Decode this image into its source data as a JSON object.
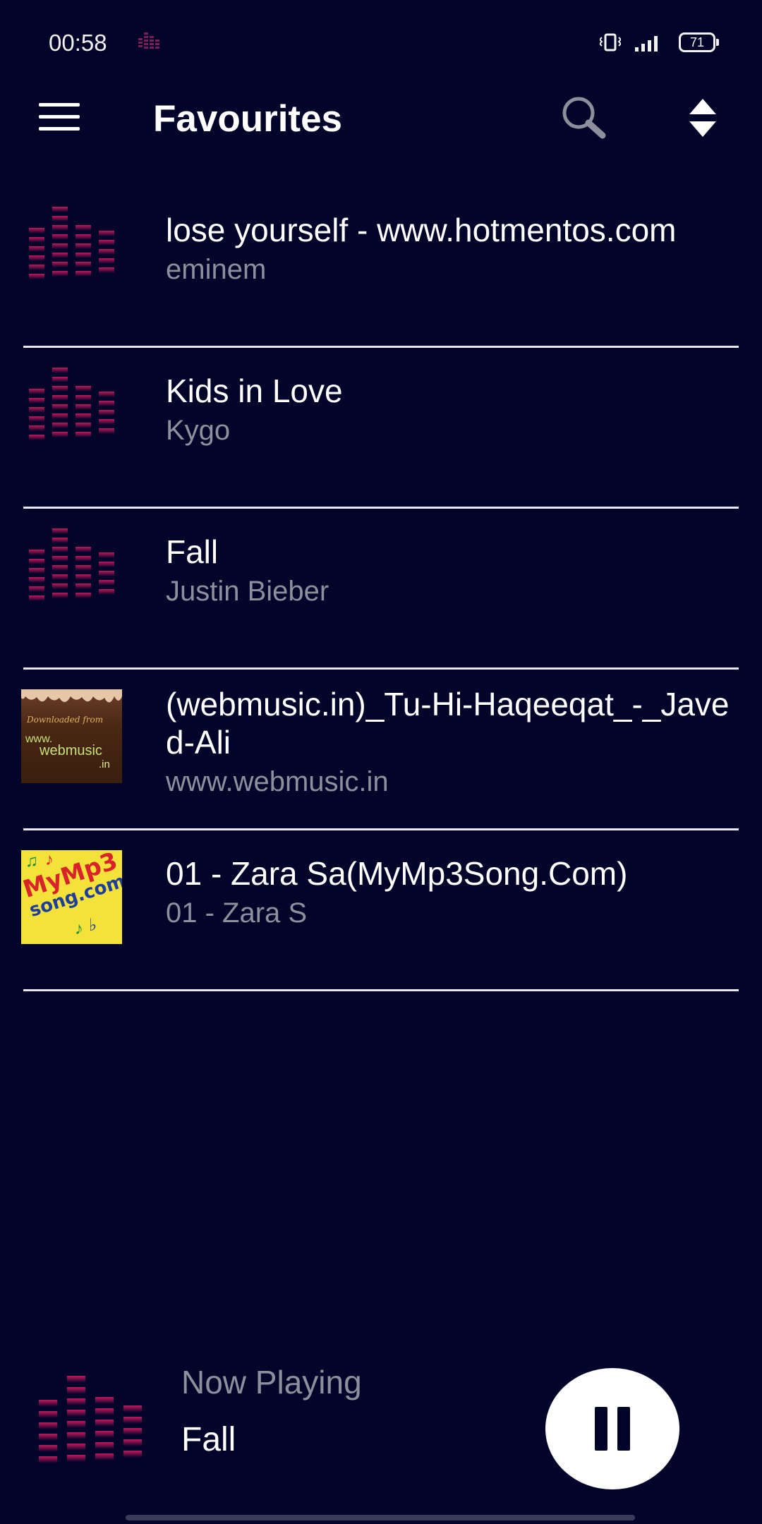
{
  "status_bar": {
    "time": "00:58",
    "battery": "71"
  },
  "app_bar": {
    "title": "Favourites"
  },
  "songs": [
    {
      "title": "lose yourself - www.hotmentos.com",
      "artist": "eminem",
      "art": "equalizer"
    },
    {
      "title": "Kids in Love",
      "artist": "Kygo",
      "art": "equalizer"
    },
    {
      "title": "Fall",
      "artist": "Justin Bieber",
      "art": "equalizer"
    },
    {
      "title": "(webmusic.in)_Tu-Hi-Haqeeqat_-_Javed-Ali",
      "artist": "www.webmusic.in",
      "art": "webmusic-cover",
      "art_text": {
        "small": "Downloaded from",
        "www": "www.",
        "main": "webmusic",
        "in": ".in"
      }
    },
    {
      "title": "01 - Zara Sa(MyMp3Song.Com)",
      "artist": "01 - Zara S",
      "art": "mymp3song-cover",
      "art_text": {
        "line1": "MyMp3",
        "line2": "song.com"
      }
    }
  ],
  "now_playing": {
    "label": "Now Playing",
    "title": "Fall"
  },
  "colors": {
    "background": "#03042a",
    "accent": "#c2185b",
    "secondary_text": "#8e8f9c",
    "divider": "#e8e8ee"
  }
}
